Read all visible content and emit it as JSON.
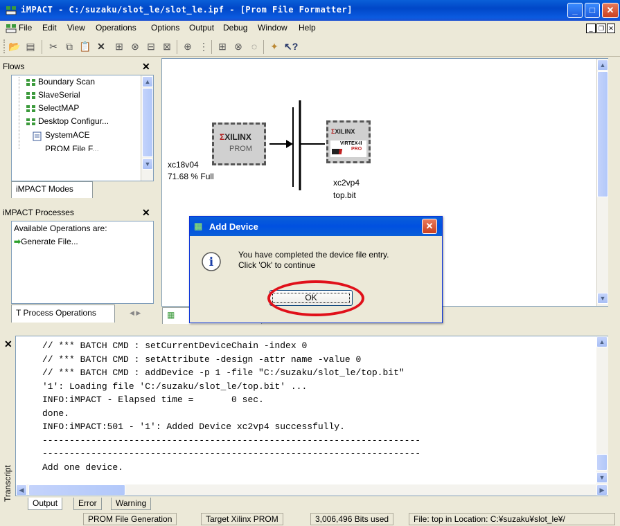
{
  "window": {
    "title": "iMPACT - C:/suzaku/slot_le/slot_le.ipf - [Prom File Formatter]"
  },
  "menu": [
    "File",
    "Edit",
    "View",
    "Operations",
    "Options",
    "Output",
    "Debug",
    "Window",
    "Help"
  ],
  "flows": {
    "title": "Flows",
    "items": [
      "Boundary Scan",
      "SlaveSerial",
      "SelectMAP",
      "Desktop Configur...",
      "SystemACE",
      "PROM File F..."
    ],
    "tab": "iMPACT Modes"
  },
  "processes": {
    "title": "iMPACT Processes",
    "label": "Available Operations are:",
    "item": "Generate File...",
    "tab": "T Process Operations"
  },
  "canvas": {
    "prom_device": "xc18v04",
    "prom_usage": "71.68 % Full",
    "prom_brand": "XILINX",
    "prom_label": "PROM",
    "fpga_device": "xc2vp4",
    "fpga_file": "top.bit",
    "fpga_brand": "XILINX",
    "fpga_family": "VIRTEX-II",
    "fpga_sub": "PRO"
  },
  "dialog": {
    "title": "Add Device",
    "message_line1": "You have completed the device file entry.",
    "message_line2": "Click 'Ok' to continue",
    "ok_label": "OK"
  },
  "transcript": {
    "label": "Transcript",
    "lines": [
      "// *** BATCH CMD : setCurrentDeviceChain -index 0",
      "// *** BATCH CMD : setAttribute -design -attr name -value 0",
      "// *** BATCH CMD : addDevice -p 1 -file \"C:/suzaku/slot_le/top.bit\"",
      "'1': Loading file 'C:/suzaku/slot_le/top.bit' ...",
      "INFO:iMPACT - Elapsed time =       0 sec.",
      "done.",
      "INFO:iMPACT:501 - '1': Added Device xc2vp4 successfully.",
      "----------------------------------------------------------------------",
      "----------------------------------------------------------------------",
      "Add one device."
    ],
    "tabs": [
      "Output",
      "Error",
      "Warning"
    ]
  },
  "status": [
    "PROM File Generation",
    "Target Xilinx PROM",
    "3,006,496 Bits used",
    "File: top in Location: C:¥suzaku¥slot_le¥/"
  ]
}
